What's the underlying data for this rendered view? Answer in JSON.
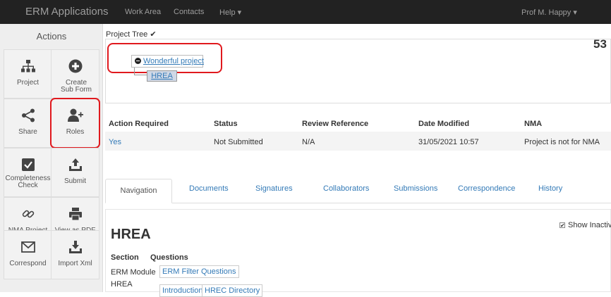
{
  "topnav": {
    "brand": "ERM Applications",
    "links": [
      "Work Area",
      "Contacts",
      "Help ▾"
    ],
    "user": "Prof M. Happy ▾"
  },
  "sidebar": {
    "title": "Actions",
    "tiles": [
      {
        "label": "Project",
        "icon": "hierarchy-icon"
      },
      {
        "label": "Create Sub Form",
        "icon": "plus-circle-icon"
      },
      {
        "label": "Share",
        "icon": "share-icon"
      },
      {
        "label": "Roles",
        "icon": "user-plus-icon"
      },
      {
        "label": "Completeness Check",
        "icon": "checkbox-icon"
      },
      {
        "label": "Submit",
        "icon": "upload-icon"
      },
      {
        "label": "NMA Project",
        "icon": "link-icon"
      },
      {
        "label": "View as PDF",
        "icon": "print-icon"
      },
      {
        "label": "Correspond",
        "icon": "envelope-icon"
      },
      {
        "label": "Import Xml",
        "icon": "import-icon"
      }
    ]
  },
  "project_tree": {
    "title": "Project Tree ✔",
    "number": "53",
    "root_node": "Wonderful project",
    "child_node": "HREA"
  },
  "status_table": {
    "headers": [
      "Action Required",
      "Status",
      "Review Reference",
      "Date Modified",
      "NMA"
    ],
    "row": [
      "Yes",
      "Not Submitted",
      "N/A",
      "31/05/2021 10:57",
      "Project is not for NMA"
    ]
  },
  "tabs": [
    "Navigation",
    "Documents",
    "Signatures",
    "Collaborators",
    "Submissions",
    "Correspondence",
    "History"
  ],
  "navigation": {
    "title": "HREA",
    "show_inactive": "Show Inactive",
    "show_inactive_checked": "✔",
    "section_header": "Section",
    "questions_header": "Questions",
    "rows": [
      {
        "section": "ERM Module",
        "links": [
          "ERM Filter Questions"
        ]
      },
      {
        "section": "HREA",
        "links": [
          "Introduction",
          "HREC Directory"
        ]
      }
    ]
  },
  "colors": {
    "highlight": "#e0191e",
    "link": "#337ab7",
    "navbar": "#222222"
  }
}
